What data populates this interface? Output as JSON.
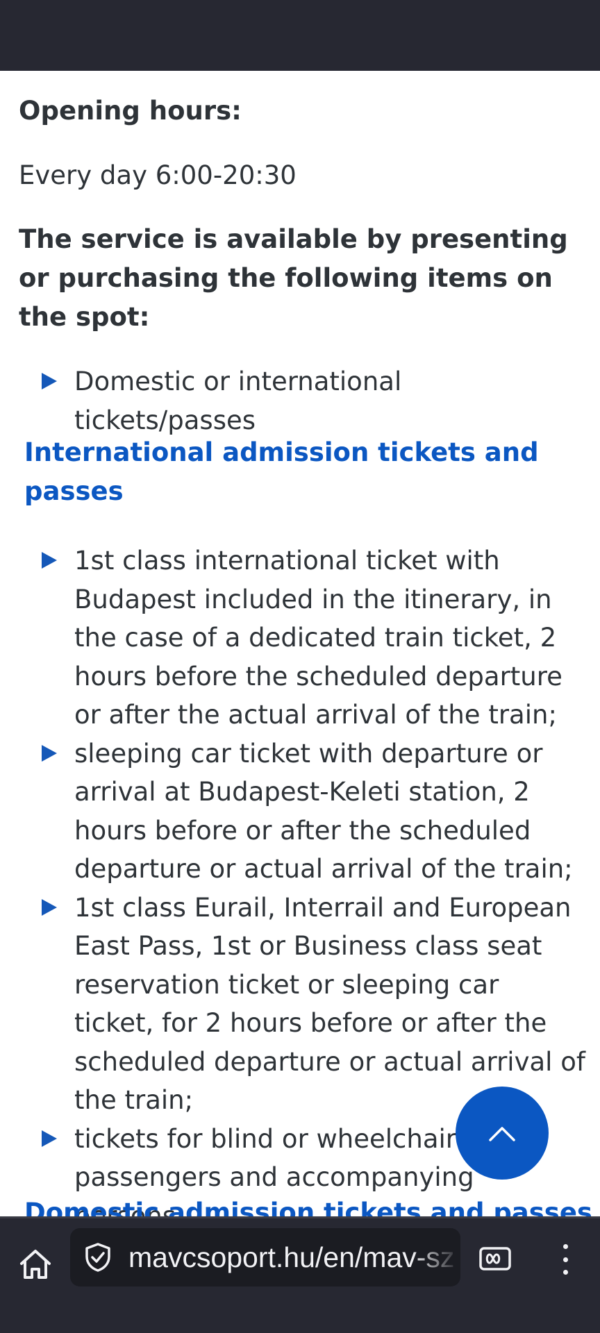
{
  "page": {
    "opening_hours_heading": "Opening hours:",
    "opening_hours_text": "Every day 6:00-20:30",
    "service_intro": "The service is available by presenting or purchasing the following items on the spot:",
    "service_items": [
      "Domestic or international tickets/passes"
    ],
    "international_heading": "International admission tickets and passes",
    "international_items": [
      "1st class international ticket with Budapest included in the itinerary, in the case of a dedicated train ticket, 2 hours before the scheduled departure or after the actual arrival of the train;",
      "sleeping car ticket with departure or arrival at Budapest-Keleti station, 2 hours before or after the scheduled departure or actual arrival of the train;",
      "1st class Eurail, Interrail and European East Pass, 1st or Business class seat reservation ticket or sleeping car ticket, for 2 hours before or after the scheduled departure or actual arrival of the train;",
      "tickets for blind or wheelchair passengers and accompanying persons."
    ],
    "domestic_heading": "Domestic admission tickets and passes"
  },
  "browser": {
    "url": "mavcsoport.hu/en/mav-sz"
  },
  "icons": {
    "home": "home-icon",
    "site_security": "shield-check-icon",
    "reader_mode": "reader-mode-icon",
    "menu": "overflow-menu-icon",
    "scroll_top": "chevron-up-icon"
  },
  "colors": {
    "link_blue": "#0b57c2",
    "bullet_blue": "#1558b8",
    "chrome_dark": "#272832",
    "text": "#2e3338"
  }
}
